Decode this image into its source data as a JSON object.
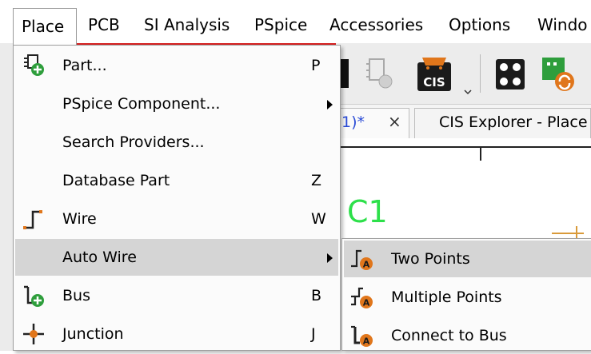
{
  "menubar": {
    "items": [
      "Place",
      "PCB",
      "SI Analysis",
      "PSpice",
      "Accessories",
      "Options",
      "Windo"
    ]
  },
  "tabs": {
    "active_fragment": "1)*",
    "close_glyph": "×",
    "other": "CIS Explorer - Place"
  },
  "canvas": {
    "label": "C1"
  },
  "place_menu": {
    "items": [
      {
        "label": "Part...",
        "shortcut": "P",
        "icon": "place-part-icon"
      },
      {
        "label": "PSpice Component...",
        "shortcut": "",
        "icon": "",
        "submenu": true
      },
      {
        "label": "Search Providers...",
        "shortcut": "",
        "icon": ""
      },
      {
        "label": "Database Part",
        "shortcut": "Z",
        "icon": ""
      },
      {
        "label": "Wire",
        "shortcut": "W",
        "icon": "wire-icon"
      },
      {
        "label": "Auto Wire",
        "shortcut": "",
        "icon": "",
        "submenu": true,
        "highlighted": true
      },
      {
        "label": "Bus",
        "shortcut": "B",
        "icon": "bus-icon"
      },
      {
        "label": "Junction",
        "shortcut": "J",
        "icon": "junction-icon"
      }
    ]
  },
  "auto_wire_submenu": {
    "items": [
      {
        "label": "Two Points",
        "icon": "auto-wire-two-points-icon",
        "highlighted": true
      },
      {
        "label": "Multiple Points",
        "icon": "auto-wire-multiple-points-icon"
      },
      {
        "label": "Connect to Bus",
        "icon": "auto-wire-connect-bus-icon"
      }
    ]
  },
  "colors": {
    "accent_red": "#d42020",
    "highlight": "#d5d5d5",
    "icon_orange": "#e0761b",
    "icon_green": "#2e9e3c",
    "net_label_green": "#2de04a",
    "tab_blue": "#2a4bd6"
  }
}
